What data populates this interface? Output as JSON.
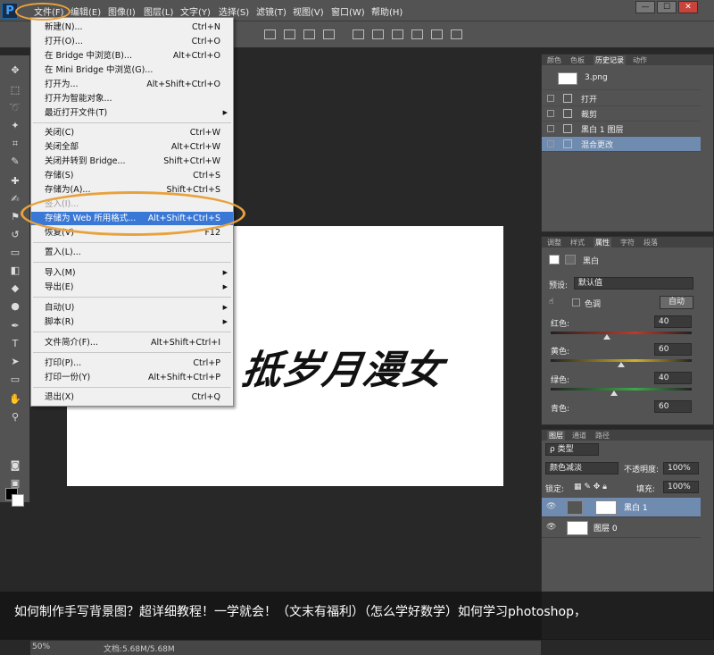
{
  "app": {
    "logo": "P"
  },
  "menubar": {
    "items": [
      "文件(F)",
      "编辑(E)",
      "图像(I)",
      "图层(L)",
      "文字(Y)",
      "选择(S)",
      "滤镜(T)",
      "视图(V)",
      "窗口(W)",
      "帮助(H)"
    ],
    "window_buttons": [
      "—",
      "☐",
      "✕"
    ]
  },
  "file_menu": {
    "items": [
      {
        "label": "新建(N)...",
        "shortcut": "Ctrl+N"
      },
      {
        "label": "打开(O)...",
        "shortcut": "Ctrl+O"
      },
      {
        "label": "在 Bridge 中浏览(B)...",
        "shortcut": "Alt+Ctrl+O"
      },
      {
        "label": "在 Mini Bridge 中浏览(G)...",
        "shortcut": ""
      },
      {
        "label": "打开为...",
        "shortcut": "Alt+Shift+Ctrl+O"
      },
      {
        "label": "打开为智能对象...",
        "shortcut": ""
      },
      {
        "label": "最近打开文件(T)",
        "shortcut": ""
      },
      {
        "label": "关闭(C)",
        "shortcut": "Ctrl+W"
      },
      {
        "label": "关闭全部",
        "shortcut": "Alt+Ctrl+W"
      },
      {
        "label": "关闭并转到 Bridge...",
        "shortcut": "Shift+Ctrl+W"
      },
      {
        "label": "存储(S)",
        "shortcut": "Ctrl+S"
      },
      {
        "label": "存储为(A)...",
        "shortcut": "Shift+Ctrl+S"
      },
      {
        "label": "签入(I)...",
        "shortcut": ""
      },
      {
        "label": "存储为 Web 所用格式...",
        "shortcut": "Alt+Shift+Ctrl+S"
      },
      {
        "label": "恢复(V)",
        "shortcut": "F12"
      },
      {
        "label": "置入(L)...",
        "shortcut": ""
      },
      {
        "label": "导入(M)",
        "shortcut": ""
      },
      {
        "label": "导出(E)",
        "shortcut": ""
      },
      {
        "label": "自动(U)",
        "shortcut": ""
      },
      {
        "label": "脚本(R)",
        "shortcut": ""
      },
      {
        "label": "文件简介(F)...",
        "shortcut": "Alt+Shift+Ctrl+I"
      },
      {
        "label": "打印(P)...",
        "shortcut": "Ctrl+P"
      },
      {
        "label": "打印一份(Y)",
        "shortcut": "Alt+Shift+Ctrl+P"
      },
      {
        "label": "退出(X)",
        "shortcut": "Ctrl+Q"
      }
    ]
  },
  "canvas": {
    "text": "抵岁月漫女"
  },
  "history_panel": {
    "tabs": [
      "颜色",
      "色板",
      "历史记录",
      "动作"
    ],
    "snapshot": "3.png",
    "steps": [
      "打开",
      "裁剪",
      "黑白 1 图层",
      "混合更改"
    ]
  },
  "properties_panel": {
    "tabs": [
      "调整",
      "样式",
      "属性",
      "字符",
      "段落"
    ],
    "title": "黑白",
    "preset_label": "预设:",
    "preset_value": "默认值",
    "tint_label": "色调",
    "auto_button": "自动",
    "sliders": [
      {
        "label": "红色:",
        "value": "40",
        "fraction": 0.4,
        "color": "#c0392b"
      },
      {
        "label": "黄色:",
        "value": "60",
        "fraction": 0.5,
        "color": "#d4b02a"
      },
      {
        "label": "绿色:",
        "value": "40",
        "fraction": 0.45,
        "color": "#3ea84a"
      },
      {
        "label": "青色:",
        "value": "60",
        "fraction": 0.55,
        "color": "#3ab7c8"
      }
    ]
  },
  "layers_panel": {
    "tabs": [
      "图层",
      "通道",
      "路径"
    ],
    "filter_label": "ρ 类型",
    "blend_mode": "颜色减淡",
    "opacity_label": "不透明度:",
    "opacity_value": "100%",
    "lock_label": "锁定:",
    "fill_label": "填充:",
    "fill_value": "100%",
    "layers": [
      {
        "name": "黑白 1",
        "selected": true
      },
      {
        "name": "图层 0",
        "selected": false
      }
    ]
  },
  "statusbar": {
    "zoom": "50%",
    "doc_info": "文档:5.68M/5.68M"
  },
  "caption": {
    "text": "如何制作手写背景图？超详细教程！一学就会！（文末有福利）（怎么学好数学）如何学习photoshop，"
  }
}
